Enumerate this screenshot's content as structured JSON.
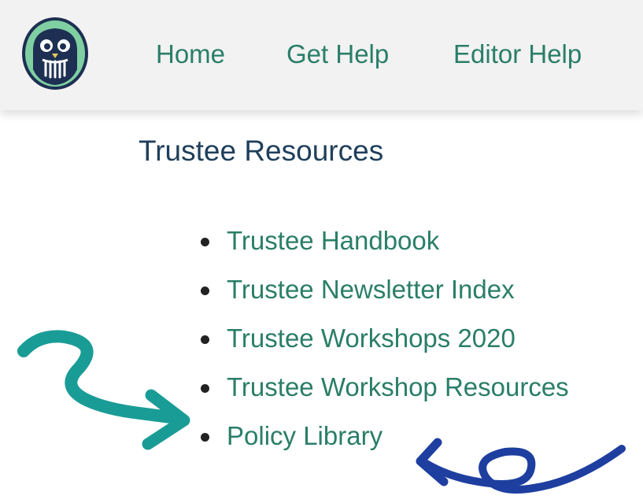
{
  "header": {
    "logo_icon": "owl-logo-icon",
    "nav": [
      {
        "label": "Home"
      },
      {
        "label": "Get Help"
      },
      {
        "label": "Editor Help"
      }
    ]
  },
  "main": {
    "title": "Trustee Resources",
    "links": [
      {
        "label": "Trustee Handbook"
      },
      {
        "label": "Trustee Newsletter Index"
      },
      {
        "label": "Trustee Workshops 2020"
      },
      {
        "label": "Trustee Workshop Resources"
      },
      {
        "label": "Policy Library"
      }
    ]
  },
  "annotations": {
    "left_arrow_icon": "curly-arrow-right-icon",
    "left_arrow_color": "#1a9c96",
    "right_arrow_icon": "loop-arrow-left-icon",
    "right_arrow_color": "#1e3fa0"
  },
  "colors": {
    "link": "#2a7e68",
    "title": "#1f3f5b",
    "header_bg": "#f2f2f2"
  }
}
